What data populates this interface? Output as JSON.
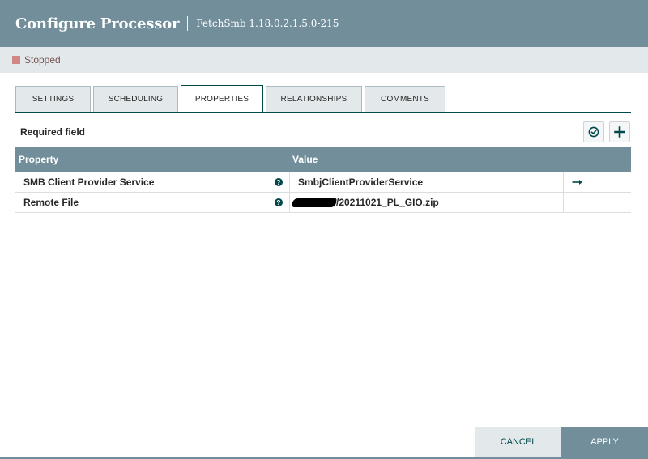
{
  "header": {
    "title": "Configure Processor",
    "subtitle": "FetchSmb 1.18.0.2.1.5.0-215"
  },
  "status": {
    "text": "Stopped",
    "color": "#d18686"
  },
  "tabs": [
    {
      "label": "SETTINGS",
      "active": false
    },
    {
      "label": "SCHEDULING",
      "active": false
    },
    {
      "label": "PROPERTIES",
      "active": true
    },
    {
      "label": "RELATIONSHIPS",
      "active": false
    },
    {
      "label": "COMMENTS",
      "active": false
    }
  ],
  "properties": {
    "required_label": "Required field",
    "verify_icon": "check-circle-icon",
    "add_icon": "plus-icon",
    "columns": {
      "property": "Property",
      "value": "Value"
    },
    "rows": [
      {
        "property": "SMB Client Provider Service",
        "value": "SmbjClientProviderService",
        "action_icon": "arrow-right-icon"
      },
      {
        "property": "Remote File",
        "value": "/20211021_PL_GIO.zip",
        "redacted_prefix": true
      }
    ]
  },
  "footer": {
    "cancel_label": "CANCEL",
    "apply_label": "APPLY"
  },
  "colors": {
    "header_bg": "#728e9b",
    "accent": "#004849",
    "status_bar_bg": "#e3e8eb"
  }
}
